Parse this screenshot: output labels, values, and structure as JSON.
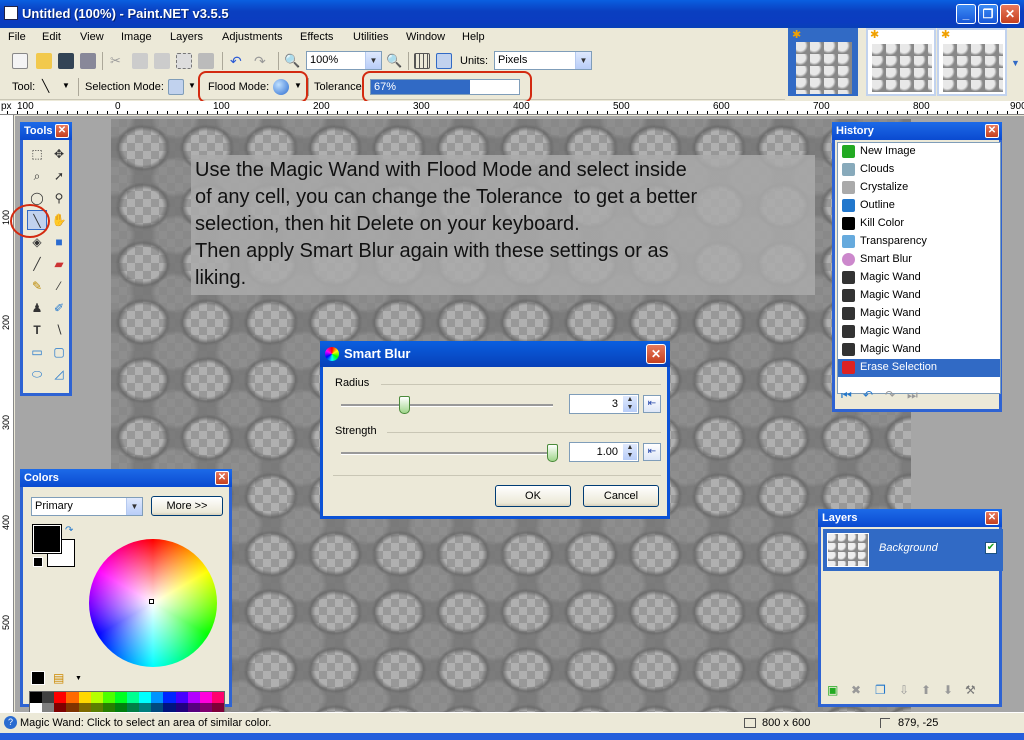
{
  "window": {
    "title": "Untitled (100%) - Paint.NET v3.5.5"
  },
  "menu": [
    "File",
    "Edit",
    "View",
    "Image",
    "Layers",
    "Adjustments",
    "Effects",
    "Utilities",
    "Window",
    "Help"
  ],
  "toolbar": {
    "zoom_value": "100%",
    "units_label": "Units:",
    "units_value": "Pixels",
    "tool_label": "Tool:",
    "selection_mode_label": "Selection Mode:",
    "flood_mode_label": "Flood Mode:",
    "tolerance_label": "Tolerance:",
    "tolerance_value": "67%",
    "tolerance_fraction": 0.67
  },
  "ruler": {
    "unit": "px",
    "top_ticks": [
      "100",
      "0",
      "100",
      "200",
      "300",
      "400",
      "500",
      "600",
      "700",
      "800",
      "900"
    ],
    "left_ticks": [
      "100",
      "200",
      "300",
      "400",
      "500"
    ]
  },
  "instructions": {
    "text": "Use the Magic Wand with Flood Mode and select inside\nof any cell, you can change the Tolerance  to get a better\nselection, then hit Delete on your keyboard.\nThen apply Smart Blur again with these settings or as\nliking."
  },
  "tools_panel": {
    "title": "Tools"
  },
  "colors_panel": {
    "title": "Colors",
    "mode": "Primary",
    "more_button": "More >>",
    "primary_color": "#000000",
    "secondary_color": "#ffffff"
  },
  "history_panel": {
    "title": "History",
    "items": [
      {
        "label": "New Image",
        "icon": "new-image-icon"
      },
      {
        "label": "Clouds",
        "icon": "clouds-icon"
      },
      {
        "label": "Crystalize",
        "icon": "crystalize-icon"
      },
      {
        "label": "Outline",
        "icon": "outline-icon"
      },
      {
        "label": "Kill Color",
        "icon": "skull-icon"
      },
      {
        "label": "Transparency",
        "icon": "transparency-icon"
      },
      {
        "label": "Smart Blur",
        "icon": "smart-blur-icon"
      },
      {
        "label": "Magic Wand",
        "icon": "magic-wand-icon"
      },
      {
        "label": "Magic Wand",
        "icon": "magic-wand-icon"
      },
      {
        "label": "Magic Wand",
        "icon": "magic-wand-icon"
      },
      {
        "label": "Magic Wand",
        "icon": "magic-wand-icon"
      },
      {
        "label": "Magic Wand",
        "icon": "magic-wand-icon"
      },
      {
        "label": "Erase Selection",
        "icon": "erase-selection-icon"
      }
    ],
    "selected_index": 12
  },
  "smart_blur_dialog": {
    "title": "Smart Blur",
    "radius_label": "Radius",
    "radius_value": "3",
    "radius_fraction": 0.3,
    "strength_label": "Strength",
    "strength_value": "1.00",
    "strength_fraction": 1.0,
    "ok_label": "OK",
    "cancel_label": "Cancel"
  },
  "layers_panel": {
    "title": "Layers",
    "layers": [
      {
        "name": "Background",
        "visible": true
      }
    ]
  },
  "status": {
    "message": "Magic Wand: Click to select an area of similar color.",
    "image_size": "800 x 600",
    "cursor_position": "879, -25"
  },
  "colors": {
    "accent": "#316ac5",
    "titlebar": "#0a4ad0",
    "highlight_ring": "#d32a10"
  }
}
